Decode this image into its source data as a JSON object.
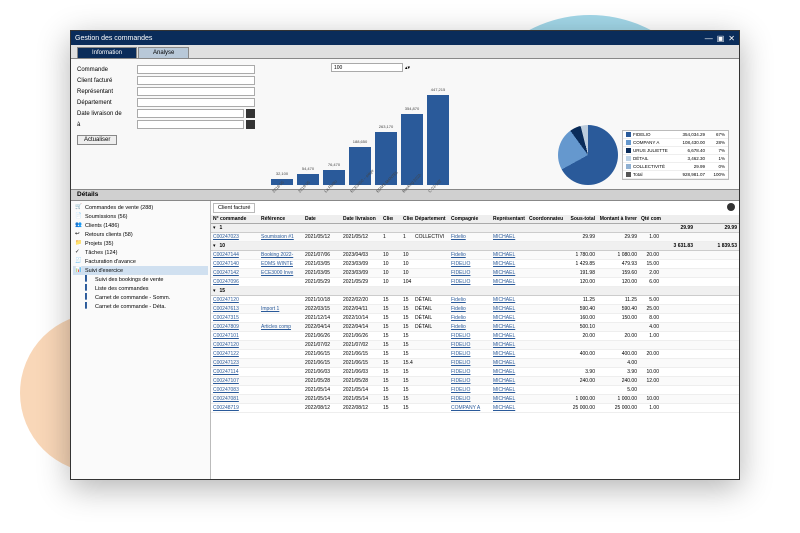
{
  "window": {
    "title": "Gestion des commandes"
  },
  "tabs": [
    {
      "label": "Information",
      "active": true
    },
    {
      "label": "Analyse",
      "active": false
    }
  ],
  "filters": {
    "rows": [
      {
        "label": "Commande"
      },
      {
        "label": "Client facturé"
      },
      {
        "label": "Représentant"
      },
      {
        "label": "Département"
      },
      {
        "label": "Date livraison de"
      },
      {
        "label": "à"
      }
    ],
    "limit": "100",
    "action": "Actualiser"
  },
  "chart_data": {
    "type": "bar",
    "title": "",
    "xlabel": "",
    "ylabel": "",
    "categories": [
      "2018-05",
      "2019-05",
      "La Radio",
      "ECE3000 – siège",
      "EDMS MANTEL",
      "Booking 2022-",
      "C 03-102"
    ],
    "values": [
      32100,
      54470,
      76470,
      188650,
      263170,
      354870,
      447215
    ],
    "pie": {
      "series": [
        {
          "name": "FIDELIO",
          "value": 354034.29,
          "pct": 67,
          "color": "#2a5a9a"
        },
        {
          "name": "COMPANY A",
          "value": 108430.0,
          "pct": 28,
          "color": "#6598ce"
        },
        {
          "name": "URUS JULIETTE",
          "value": 6678.4,
          "pct": 7,
          "color": "#0a2c5a"
        },
        {
          "name": "DÉTAIL",
          "value": 3462.3,
          "pct": 1,
          "color": "#bcd2e6"
        },
        {
          "name": "COLLECTIVITÉ",
          "value": 29.99,
          "pct": 0,
          "color": "#8fb0d2"
        },
        {
          "name": "Total",
          "value": 928981.07,
          "pct": 100,
          "color": "#555"
        }
      ]
    }
  },
  "details": {
    "title": "Détails"
  },
  "sidebar": {
    "items": [
      {
        "icon": "🛒",
        "label": "Commandes de vente (288)"
      },
      {
        "icon": "📄",
        "label": "Soumissions (56)"
      },
      {
        "icon": "👥",
        "label": "Clients (1486)"
      },
      {
        "icon": "↩",
        "label": "Retours clients (58)"
      },
      {
        "icon": "📁",
        "label": "Projets (35)"
      },
      {
        "icon": "✓",
        "label": "Tâches (124)"
      },
      {
        "icon": "🧾",
        "label": "Facturation d'avance"
      },
      {
        "icon": "📊",
        "label": "Suivi d'exercice",
        "selected": true
      }
    ],
    "sub": [
      {
        "icon": "▌",
        "label": "Suivi des bookings de vente"
      },
      {
        "icon": "▌",
        "label": "Liste des commandes"
      },
      {
        "icon": "▌",
        "label": "Carnet de commande - Somm."
      },
      {
        "icon": "▌",
        "label": "Carnet de commande - Déta."
      }
    ]
  },
  "grid": {
    "group_by": "Client facturé",
    "columns": [
      "N° commande",
      "Référence",
      "Date",
      "Date livraison",
      "Client facturé",
      "",
      "Client livré",
      "Département",
      "Compagnie",
      "Représentant",
      "Coordonnateur",
      "Sous-total",
      "Montant à livrer",
      "Qté comm."
    ],
    "groups": [
      {
        "key": "1",
        "subtotal": "29.99",
        "montant": "29.99",
        "rows": [
          {
            "num": "C00247023",
            "ref": "Soumission #1",
            "date": "2021/05/12",
            "dl": "2021/05/12",
            "cf": "1",
            "cl": "1",
            "dep": "COLLECTIVI",
            "comp": "Fidelio",
            "rep": "MICHAEL",
            "coord": "",
            "st": "29.99",
            "ml": "29.99",
            "qc": "1.00"
          }
        ]
      },
      {
        "key": "10",
        "subtotal": "3 631.83",
        "montant": "1 839.53",
        "rows": [
          {
            "num": "C00247144",
            "ref": "Booking 2022-",
            "date": "2021/07/06",
            "dl": "2023/04/03",
            "cf": "10",
            "cl": "10",
            "dep": "",
            "comp": "Fidelio",
            "rep": "MICHAEL",
            "coord": "",
            "st": "1 780.00",
            "ml": "1 080.00",
            "qc": "20.00"
          },
          {
            "num": "C00247140",
            "ref": "EDMS WINTE",
            "date": "2021/03/05",
            "dl": "2023/03/09",
            "cf": "10",
            "cl": "10",
            "dep": "",
            "comp": "FIDELIO",
            "rep": "MICHAEL",
            "coord": "",
            "st": "1 429.85",
            "ml": "479.93",
            "qc": "15.00"
          },
          {
            "num": "C00247142",
            "ref": "ECE3000 Inve",
            "date": "2021/03/05",
            "dl": "2023/03/09",
            "cf": "10",
            "cl": "10",
            "dep": "",
            "comp": "FIDELIO",
            "rep": "MICHAEL",
            "coord": "",
            "st": "191.98",
            "ml": "159.60",
            "qc": "2.00"
          },
          {
            "num": "C00247096",
            "ref": "",
            "date": "2021/05/29",
            "dl": "2021/05/29",
            "cf": "10",
            "cl": "104",
            "dep": "",
            "comp": "FIDELIO",
            "rep": "MICHAEL",
            "coord": "",
            "st": "120.00",
            "ml": "120.00",
            "qc": "6.00"
          }
        ]
      },
      {
        "key": "15",
        "subtotal": "",
        "montant": "",
        "rows": [
          {
            "num": "C00247120",
            "ref": "",
            "date": "2021/10/18",
            "dl": "2022/02/20",
            "cf": "15",
            "cl": "15",
            "dep": "DÉTAIL",
            "comp": "Fidelio",
            "rep": "MICHAEL",
            "coord": "",
            "st": "11.25",
            "ml": "11.25",
            "qc": "5.00"
          },
          {
            "num": "C00247613",
            "ref": "Import 1",
            "date": "2022/03/15",
            "dl": "2022/04/11",
            "cf": "15",
            "cl": "15",
            "dep": "DÉTAIL",
            "comp": "Fidelio",
            "rep": "MICHAEL",
            "coord": "",
            "st": "590.40",
            "ml": "590.40",
            "qc": "25.00"
          },
          {
            "num": "C00247315",
            "ref": "",
            "date": "2021/12/14",
            "dl": "2022/10/14",
            "cf": "15",
            "cl": "15",
            "dep": "DÉTAIL",
            "comp": "Fidelio",
            "rep": "MICHAEL",
            "coord": "",
            "st": "160.00",
            "ml": "150.00",
            "qc": "8.00"
          },
          {
            "num": "C00247809",
            "ref": "Articles comp",
            "date": "2022/04/14",
            "dl": "2022/04/14",
            "cf": "15",
            "cl": "15",
            "dep": "DÉTAIL",
            "comp": "Fidelio",
            "rep": "MICHAEL",
            "coord": "",
            "st": "500.10",
            "ml": "",
            "qc": "4.00"
          },
          {
            "num": "C00247101",
            "ref": "",
            "date": "2021/06/26",
            "dl": "2021/06/26",
            "cf": "15",
            "cl": "15",
            "dep": "",
            "comp": "FIDELIO",
            "rep": "MICHAEL",
            "coord": "",
            "st": "20.00",
            "ml": "20.00",
            "qc": "1.00"
          },
          {
            "num": "C00247120",
            "ref": "",
            "date": "2021/07/02",
            "dl": "2021/07/02",
            "cf": "15",
            "cl": "15",
            "dep": "",
            "comp": "FIDELIO",
            "rep": "MICHAEL",
            "coord": "",
            "st": "",
            "ml": "",
            "qc": ""
          },
          {
            "num": "C00247122",
            "ref": "",
            "date": "2021/06/15",
            "dl": "2021/06/15",
            "cf": "15",
            "cl": "15",
            "dep": "",
            "comp": "FIDELIO",
            "rep": "MICHAEL",
            "coord": "",
            "st": "400.00",
            "ml": "400.00",
            "qc": "20.00"
          },
          {
            "num": "C00247123",
            "ref": "",
            "date": "2021/06/15",
            "dl": "2021/06/15",
            "cf": "15",
            "cl": "15.48",
            "dep": "",
            "comp": "FIDELIO",
            "rep": "MICHAEL",
            "coord": "",
            "st": "",
            "ml": "4.00",
            "qc": ""
          },
          {
            "num": "C00247114",
            "ref": "",
            "date": "2021/06/03",
            "dl": "2021/06/03",
            "cf": "15",
            "cl": "15",
            "dep": "",
            "comp": "FIDELIO",
            "rep": "MICHAEL",
            "coord": "",
            "st": "3.90",
            "ml": "3.90",
            "qc": "10.00"
          },
          {
            "num": "C00247107",
            "ref": "",
            "date": "2021/05/28",
            "dl": "2021/05/28",
            "cf": "15",
            "cl": "15",
            "dep": "",
            "comp": "FIDELIO",
            "rep": "MICHAEL",
            "coord": "",
            "st": "240.00",
            "ml": "240.00",
            "qc": "12.00"
          },
          {
            "num": "C00247083",
            "ref": "",
            "date": "2021/05/14",
            "dl": "2021/05/14",
            "cf": "15",
            "cl": "15",
            "dep": "",
            "comp": "FIDELIO",
            "rep": "MICHAEL",
            "coord": "",
            "st": "",
            "ml": "5.00",
            "qc": ""
          },
          {
            "num": "C00247081",
            "ref": "",
            "date": "2021/05/14",
            "dl": "2021/05/14",
            "cf": "15",
            "cl": "15",
            "dep": "",
            "comp": "FIDELIO",
            "rep": "MICHAEL",
            "coord": "",
            "st": "1 000.00",
            "ml": "1 000.00",
            "qc": "10.00"
          },
          {
            "num": "C00248719",
            "ref": "",
            "date": "2022/08/12",
            "dl": "2022/08/12",
            "cf": "15",
            "cl": "15",
            "dep": "",
            "comp": "COMPANY A",
            "rep": "MICHAEL",
            "coord": "",
            "st": "25 000.00",
            "ml": "25 000.00",
            "qc": "1.00"
          }
        ]
      }
    ]
  }
}
